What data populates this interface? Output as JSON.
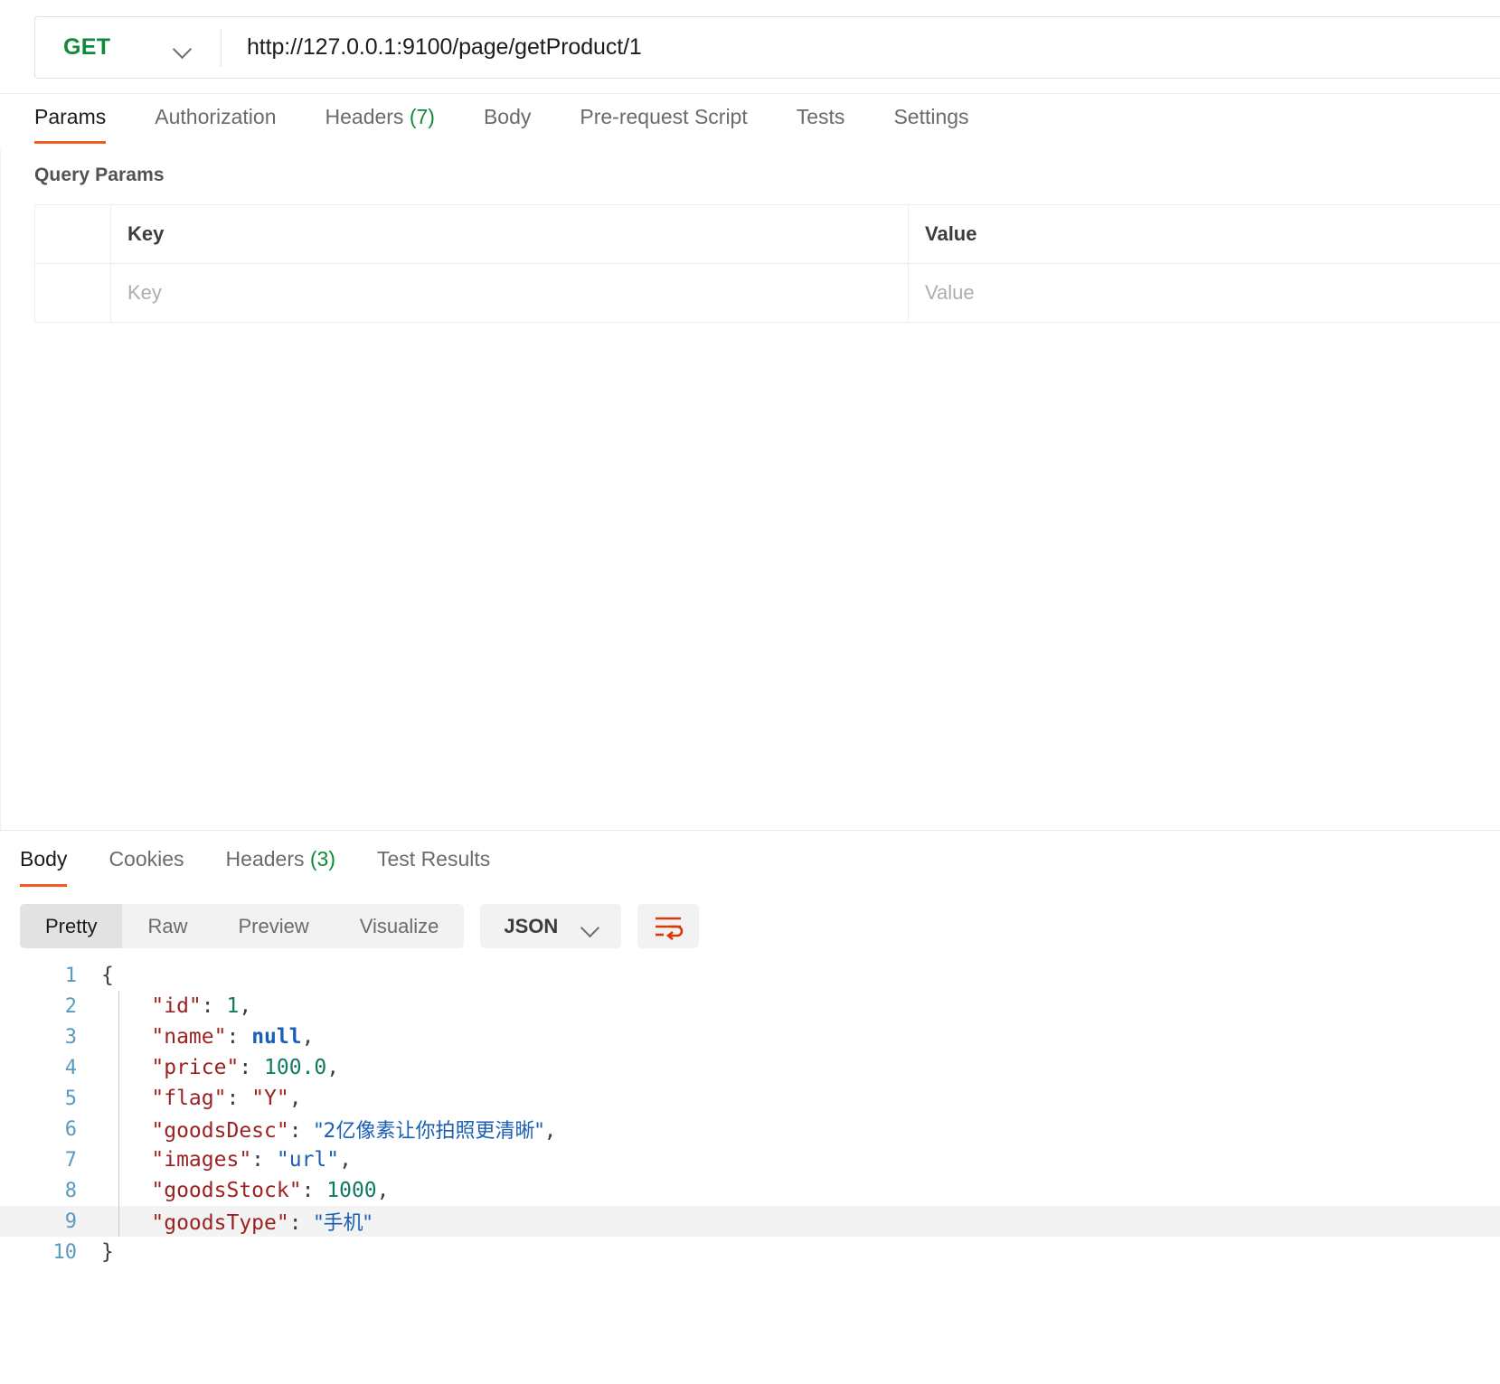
{
  "request": {
    "method": "GET",
    "url": "http://127.0.0.1:9100/page/getProduct/1",
    "tabs": [
      {
        "label": "Params",
        "count": "",
        "active": true
      },
      {
        "label": "Authorization",
        "count": "",
        "active": false
      },
      {
        "label": "Headers",
        "count": "(7)",
        "active": false
      },
      {
        "label": "Body",
        "count": "",
        "active": false
      },
      {
        "label": "Pre-request Script",
        "count": "",
        "active": false
      },
      {
        "label": "Tests",
        "count": "",
        "active": false
      },
      {
        "label": "Settings",
        "count": "",
        "active": false
      }
    ],
    "query_params": {
      "section_title": "Query Params",
      "headers": {
        "key": "Key",
        "value": "Value"
      },
      "rows": [
        {
          "key_placeholder": "Key",
          "value_placeholder": "Value"
        }
      ]
    }
  },
  "response": {
    "tabs": [
      {
        "label": "Body",
        "count": "",
        "active": true
      },
      {
        "label": "Cookies",
        "count": "",
        "active": false
      },
      {
        "label": "Headers",
        "count": "(3)",
        "active": false
      },
      {
        "label": "Test Results",
        "count": "",
        "active": false
      }
    ],
    "view_modes": [
      {
        "label": "Pretty",
        "active": true
      },
      {
        "label": "Raw",
        "active": false
      },
      {
        "label": "Preview",
        "active": false
      },
      {
        "label": "Visualize",
        "active": false
      }
    ],
    "format_selected": "JSON",
    "wrap_button_icon": "word-wrap-icon",
    "body_lines": [
      {
        "n": "1",
        "guide": false,
        "highlight": false,
        "tokens": [
          {
            "t": "{",
            "c": "br"
          }
        ]
      },
      {
        "n": "2",
        "guide": true,
        "highlight": false,
        "tokens": [
          {
            "t": "    \"id\"",
            "c": "k"
          },
          {
            "t": ": ",
            "c": "p"
          },
          {
            "t": "1",
            "c": "num"
          },
          {
            "t": ",",
            "c": "p"
          }
        ]
      },
      {
        "n": "3",
        "guide": true,
        "highlight": false,
        "tokens": [
          {
            "t": "    \"name\"",
            "c": "k"
          },
          {
            "t": ": ",
            "c": "p"
          },
          {
            "t": "null",
            "c": "nul"
          },
          {
            "t": ",",
            "c": "p"
          }
        ]
      },
      {
        "n": "4",
        "guide": true,
        "highlight": false,
        "tokens": [
          {
            "t": "    \"price\"",
            "c": "k"
          },
          {
            "t": ": ",
            "c": "p"
          },
          {
            "t": "100.0",
            "c": "num"
          },
          {
            "t": ",",
            "c": "p"
          }
        ]
      },
      {
        "n": "5",
        "guide": true,
        "highlight": false,
        "tokens": [
          {
            "t": "    \"flag\"",
            "c": "k"
          },
          {
            "t": ": ",
            "c": "p"
          },
          {
            "t": "\"Y\"",
            "c": "k"
          },
          {
            "t": ",",
            "c": "p"
          }
        ]
      },
      {
        "n": "6",
        "guide": true,
        "highlight": false,
        "tokens": [
          {
            "t": "    \"goodsDesc\"",
            "c": "k"
          },
          {
            "t": ": ",
            "c": "p"
          },
          {
            "t": "\"2亿像素让你拍照更清晰\"",
            "c": "str"
          },
          {
            "t": ",",
            "c": "p"
          }
        ]
      },
      {
        "n": "7",
        "guide": true,
        "highlight": false,
        "tokens": [
          {
            "t": "    \"images\"",
            "c": "k"
          },
          {
            "t": ": ",
            "c": "p"
          },
          {
            "t": "\"url\"",
            "c": "str"
          },
          {
            "t": ",",
            "c": "p"
          }
        ]
      },
      {
        "n": "8",
        "guide": true,
        "highlight": false,
        "tokens": [
          {
            "t": "    \"goodsStock\"",
            "c": "k"
          },
          {
            "t": ": ",
            "c": "p"
          },
          {
            "t": "1000",
            "c": "num"
          },
          {
            "t": ",",
            "c": "p"
          }
        ]
      },
      {
        "n": "9",
        "guide": true,
        "highlight": true,
        "tokens": [
          {
            "t": "    \"goodsType\"",
            "c": "k"
          },
          {
            "t": ": ",
            "c": "p"
          },
          {
            "t": "\"手机\"",
            "c": "str"
          }
        ]
      },
      {
        "n": "10",
        "guide": false,
        "highlight": false,
        "tokens": [
          {
            "t": "}",
            "c": "br"
          }
        ]
      }
    ]
  },
  "colors": {
    "accent": "#ef5b25",
    "method_get": "#0f8a3c",
    "count_green": "#0f8a3c",
    "json_key": "#9c2222",
    "json_string": "#1a5fb4",
    "json_number": "#0f7b5f",
    "line_number": "#5a9bbd"
  }
}
